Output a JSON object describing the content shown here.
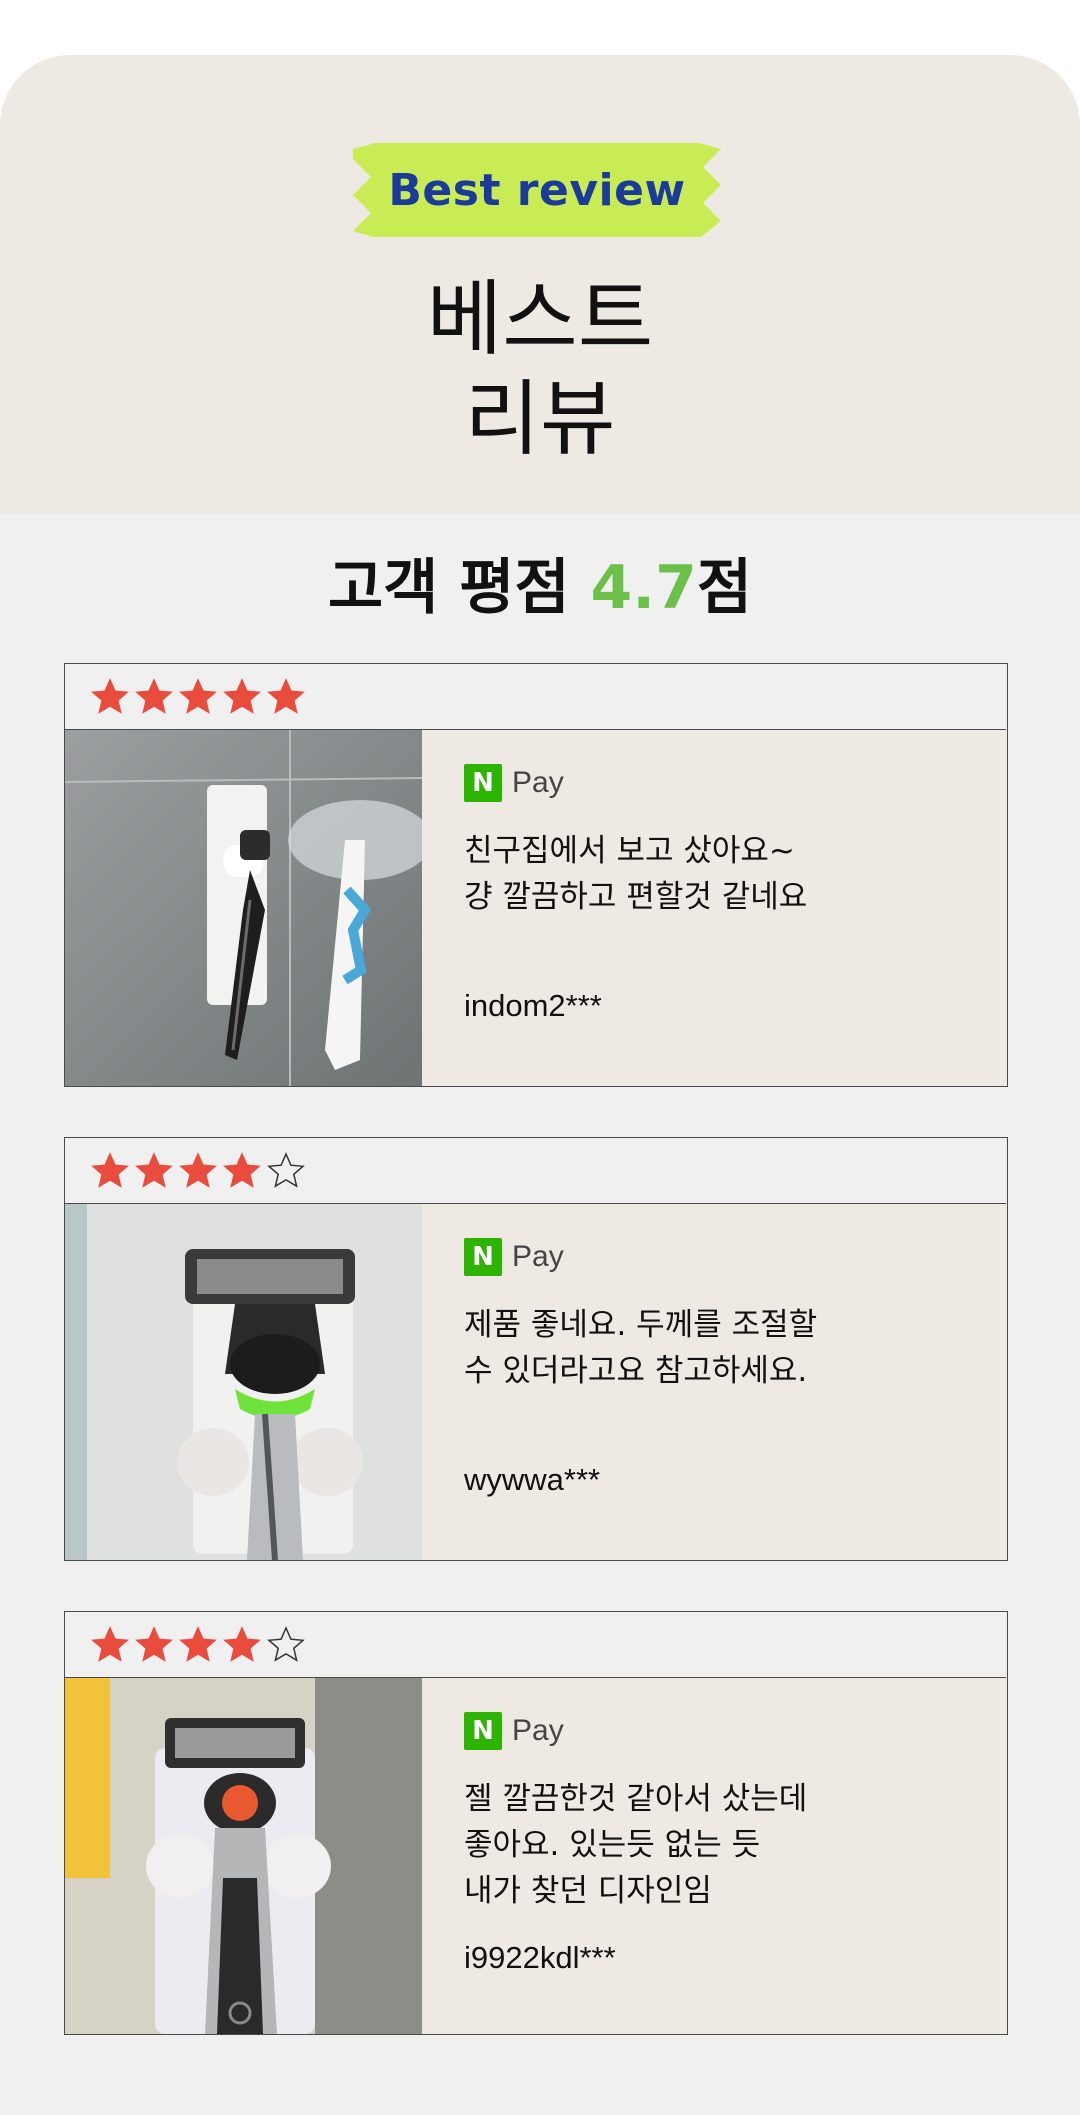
{
  "badge": {
    "label": "Best review",
    "color": "#c9ec55",
    "text_color": "#1a3a9c"
  },
  "title": {
    "line1": "베스트",
    "line2": "리뷰"
  },
  "summary": {
    "prefix": "고객 평점 ",
    "score": "4.7",
    "suffix": "점",
    "score_color": "#6cc04a"
  },
  "reviews": [
    {
      "rating": 5,
      "rating_max": 5,
      "pay_label": "Pay",
      "pay_logo": "N",
      "text": "친구집에서 보고 샀아요~\n걍 깔끔하고 편할것 같네요",
      "reviewer": "indom2***",
      "photo": "razor-holder-with-toothbrush-photo"
    },
    {
      "rating": 4,
      "rating_max": 5,
      "pay_label": "Pay",
      "pay_logo": "N",
      "text": "제품 좋네요. 두께를 조절할\n수 있더라고요 참고하세요.",
      "reviewer": "wywwa***",
      "photo": "razor-green-holder-photo"
    },
    {
      "rating": 4,
      "rating_max": 5,
      "pay_label": "Pay",
      "pay_logo": "N",
      "text": "젤 깔끔한것 같아서 샀는데\n좋아요. 있는듯 없는 듯\n내가 찾던 디자인임",
      "reviewer": "i9922kdl***",
      "photo": "razor-orange-holder-photo"
    }
  ],
  "colors": {
    "star_filled": "#e94b3c",
    "npay_green": "#2db400"
  }
}
